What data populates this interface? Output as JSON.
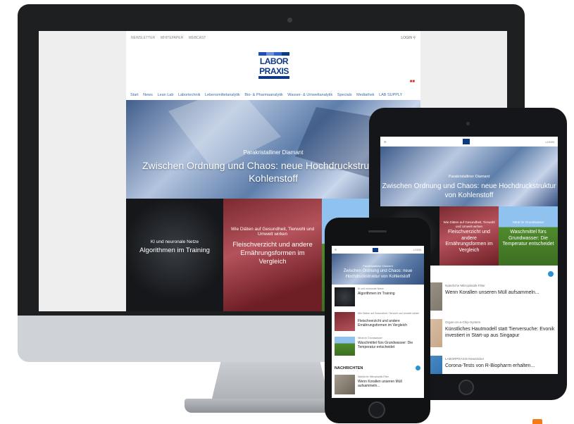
{
  "desktop": {
    "top_links": [
      "NEWSLETTER",
      "WHITEPAPER",
      "WEBCAST"
    ],
    "login": "LOGIN",
    "logo_line1": "LABOR",
    "logo_line2": "PRAXIS",
    "nav": [
      "Start",
      "News",
      "Lean Lab",
      "Labortechnik",
      "Lebensmittelanalytik",
      "Bio- & Pharmaanalytik",
      "Wasser- & Umweltanalytik",
      "Specials",
      "Mediathek",
      "LAB SUPPLY"
    ],
    "hero_kicker": "Parakristalliner Diamant",
    "hero_headline": "Zwischen Ordnung und Chaos: neue Hochdruckstruktur von Kohlenstoff",
    "tiles": [
      {
        "kicker": "KI und neuronale Netze",
        "headline": "Algorithmen im Training"
      },
      {
        "kicker": "Wie Diäten auf Gesundheit, Tierwohl und Umwelt wirken",
        "headline": "Fleischverzicht und andere Ernährungsformen im Vergleich"
      },
      {
        "kicker": "",
        "headline": ""
      }
    ]
  },
  "tablet": {
    "login": "LOGIN",
    "hero_kicker": "Parakristalliner Diamant",
    "hero_headline": "Zwischen Ordnung und Chaos: neue Hochdruckstruktur von Kohlenstoff",
    "tiles": [
      {
        "kicker": "",
        "headline": "ing"
      },
      {
        "kicker": "Wie Diäten auf Gesundheit, Tierwohl und Umwelt wirken",
        "headline": "Fleischverzicht und andere Ernährungsformen im Vergleich"
      },
      {
        "kicker": "Nitrat im Grundwasser",
        "headline": "Waschmittel fürs Grundwasser: Die Temperatur entscheidet"
      }
    ],
    "list": [
      {
        "kicker": "Natürliche Mikroplastik-Filter",
        "headline": "Wenn Korallen unseren Müll aufsammeln..."
      },
      {
        "kicker": "Organ-on-a-Chip-System",
        "headline": "Künstliches Hautmodell statt Tierversuche: Evonik investiert in Start-up aus Singapur"
      },
      {
        "kicker": "LABORPRAXIS-Newsticker",
        "headline": "Corona-Tests von R-Biopharm erhalten..."
      }
    ]
  },
  "phone": {
    "login": "LOGIN",
    "hero_kicker": "Parakristalliner Diamant",
    "hero_headline": "Zwischen Ordnung und Chaos: neue Hochdruckstruktur von Kohlenstoff",
    "items": [
      {
        "kicker": "KI und neuronale Netze",
        "headline": "Algorithmen im Training"
      },
      {
        "kicker": "Wie Diäten auf Gesundheit, Tierwohl und Umwelt wirken",
        "headline": "Fleischverzicht und andere Ernährungsformen im Vergleich"
      },
      {
        "kicker": "Nitrat im Grundwasser",
        "headline": "Waschmittel fürs Grundwasser: Die Temperatur entscheidet"
      }
    ],
    "section_title": "NACHRICHTEN",
    "news": {
      "kicker": "Natürliche Mikroplastik-Filter",
      "headline": "Wenn Korallen unseren Müll aufsammeln..."
    }
  },
  "colors": {
    "brand_blue": "#0d3a87",
    "accent": "#2a93d5",
    "orange": "#f07c1c"
  }
}
